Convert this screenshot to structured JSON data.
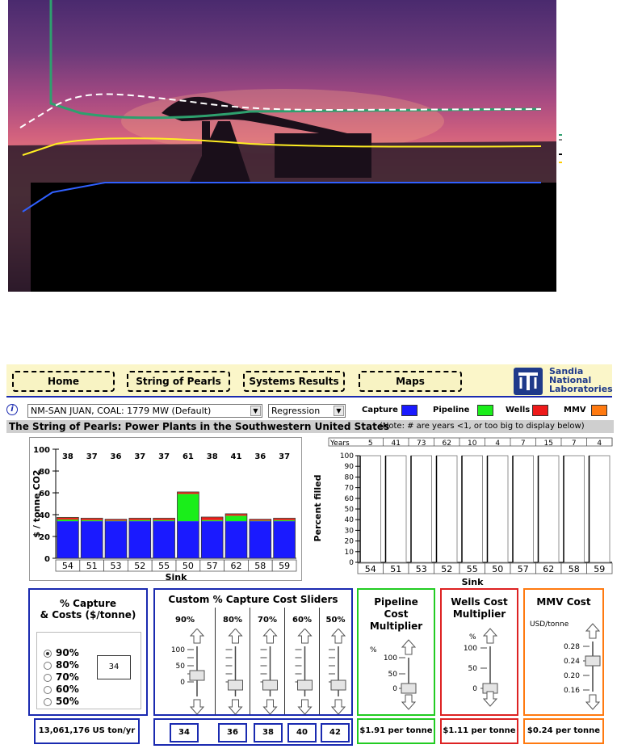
{
  "nav": {
    "buttons": [
      "Home",
      "String of Pearls",
      "Systems Results",
      "Maps"
    ],
    "logo_text": [
      "Sandia",
      "National",
      "Laboratories"
    ]
  },
  "controls": {
    "site_select": "NM-SAN JUAN, COAL: 1779 MW (Default)",
    "method_select": "Regression",
    "legend": [
      {
        "label": "Capture",
        "color": "#1a1aff"
      },
      {
        "label": "Pipeline",
        "color": "#1aee1a"
      },
      {
        "label": "Wells",
        "color": "#ee1a1a"
      },
      {
        "label": "MMV",
        "color": "#ff7a10"
      }
    ]
  },
  "title": {
    "main": "The String of Pearls:  Power Plants in the Southwestern United States",
    "note": "(Note:  # are years <1, or too big to display below)"
  },
  "cost_chart": {
    "ylabel": "$ / tonne CO2",
    "xlabel": "Sink"
  },
  "fill_chart": {
    "ylabel": "Percent filled",
    "xlabel": "Sink",
    "years_label": "Years"
  },
  "chart_data": [
    {
      "type": "bar",
      "stacked": true,
      "ylabel": "$ / tonne CO2",
      "xlabel": "Sink",
      "ylim": [
        0,
        100
      ],
      "yticks": [
        0,
        20,
        40,
        60,
        80,
        100
      ],
      "categories": [
        "54",
        "51",
        "53",
        "52",
        "55",
        "50",
        "57",
        "62",
        "58",
        "59"
      ],
      "totals": [
        "38",
        "37",
        "36",
        "37",
        "37",
        "61",
        "38",
        "41",
        "36",
        "37"
      ],
      "series": [
        {
          "name": "Capture",
          "color": "#1a1aff",
          "values": [
            34,
            34,
            34,
            34,
            34,
            34,
            34,
            34,
            34,
            34
          ]
        },
        {
          "name": "Pipeline",
          "color": "#1aee1a",
          "values": [
            1.5,
            1,
            0.5,
            1,
            1,
            25,
            1,
            5,
            0.5,
            1
          ]
        },
        {
          "name": "Wells",
          "color": "#ee1a1a",
          "values": [
            1.5,
            1.5,
            1,
            1.5,
            1.5,
            1.5,
            2.5,
            1.5,
            1,
            1.5
          ]
        },
        {
          "name": "MMV",
          "color": "#ff7a10",
          "values": [
            0.5,
            0.3,
            0.3,
            0.3,
            0.3,
            0.3,
            0.3,
            0.3,
            0.3,
            0.3
          ]
        }
      ]
    },
    {
      "type": "bar",
      "ylabel": "Percent filled",
      "xlabel": "Sink",
      "ylim": [
        0,
        100
      ],
      "yticks": [
        0,
        10,
        20,
        30,
        40,
        50,
        60,
        70,
        80,
        90,
        100
      ],
      "categories": [
        "54",
        "51",
        "53",
        "52",
        "55",
        "50",
        "57",
        "62",
        "58",
        "59"
      ],
      "years": [
        "5",
        "41",
        "73",
        "62",
        "10",
        "4",
        "7",
        "15",
        "7",
        "4"
      ],
      "values": [
        100,
        100,
        100,
        100,
        100,
        100,
        100,
        100,
        100,
        100
      ]
    }
  ],
  "capture_panel": {
    "title": "% Capture\n& Costs ($/tonne)",
    "options": [
      "90%",
      "80%",
      "70%",
      "60%",
      "50%"
    ],
    "selected": "90%",
    "value_box": "34",
    "footer": "13,061,176 US ton/yr"
  },
  "custom_sliders": {
    "title": "Custom % Capture Cost Sliders",
    "columns": [
      {
        "label": "90%",
        "value": "34"
      },
      {
        "label": "80%",
        "value": "36"
      },
      {
        "label": "70%",
        "value": "38"
      },
      {
        "label": "60%",
        "value": "40"
      },
      {
        "label": "50%",
        "value": "42"
      }
    ],
    "scale": [
      "100",
      "50",
      "0"
    ]
  },
  "pipeline_panel": {
    "title": "Pipeline\nCost\nMultiplier",
    "unit": "%",
    "scale": [
      "100",
      "50",
      "0"
    ],
    "footer": "$1.91 per tonne"
  },
  "wells_panel": {
    "title": "Wells Cost\nMultiplier",
    "unit": "%",
    "scale": [
      "100",
      "50",
      "0"
    ],
    "footer": "$1.11 per tonne"
  },
  "mmv_panel": {
    "title": "MMV Cost",
    "unit": "USD/tonne",
    "scale": [
      "0.28",
      "0.24",
      "0.20",
      "0.16"
    ],
    "footer": "$0.24 per tonne"
  }
}
